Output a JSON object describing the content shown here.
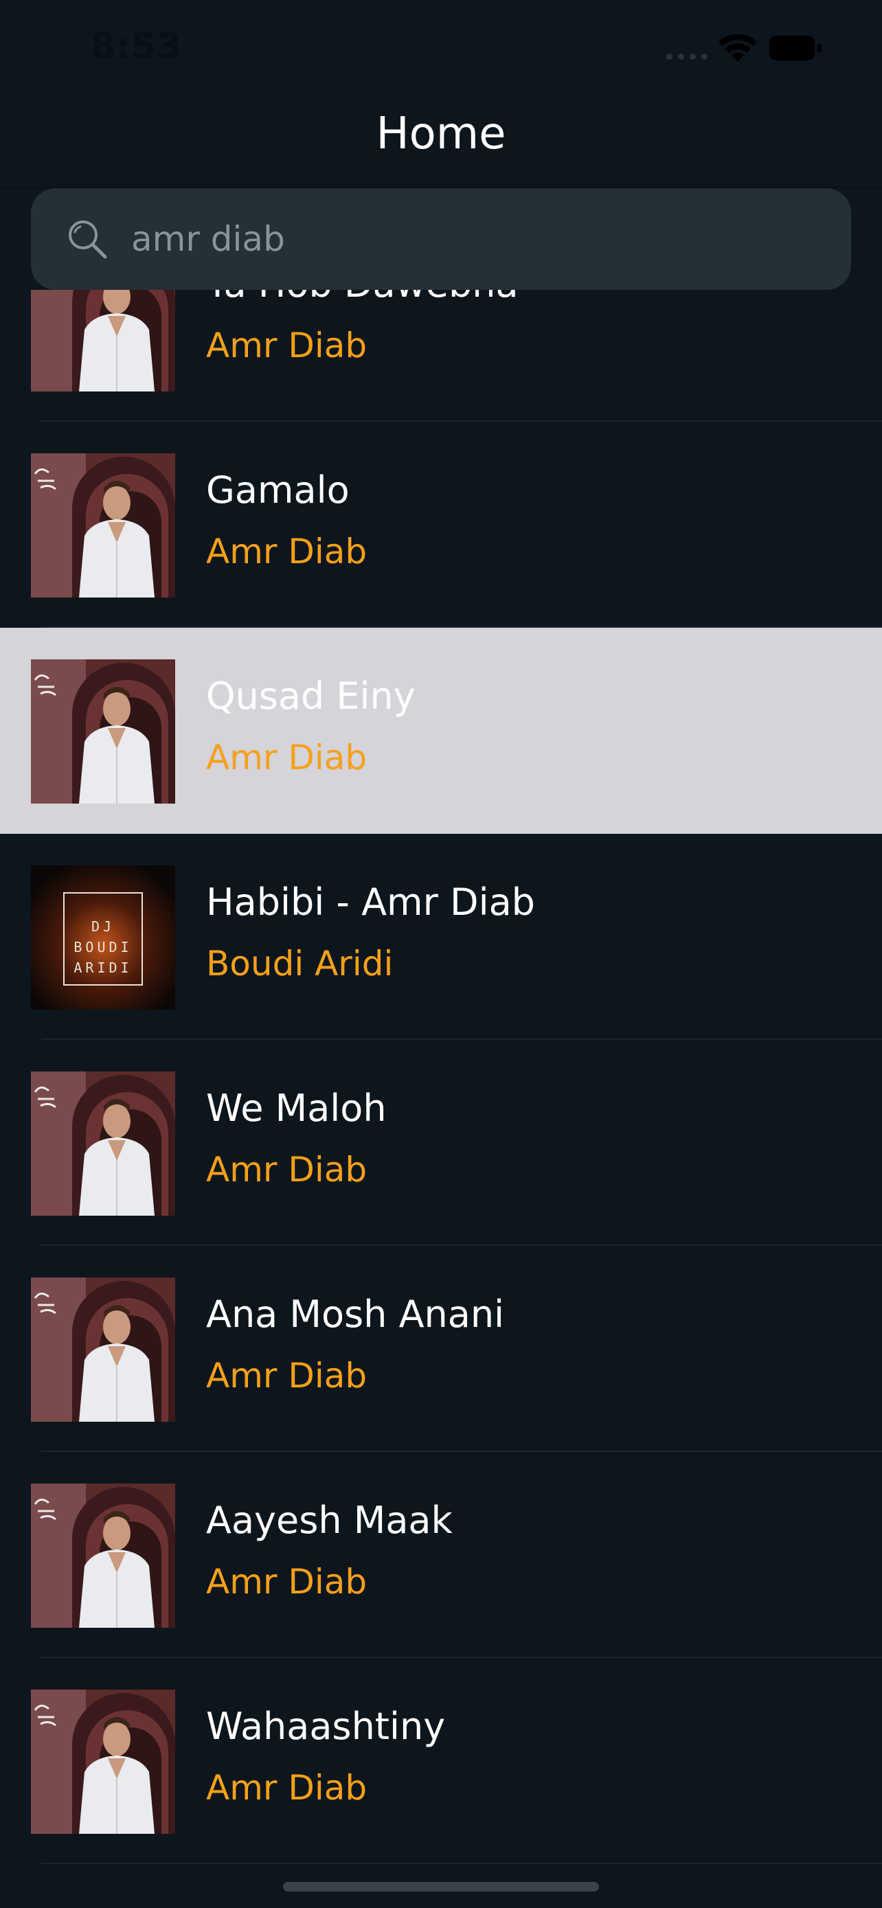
{
  "status_bar": {
    "time": "8:53"
  },
  "nav": {
    "title": "Home"
  },
  "search": {
    "value": "amr diab",
    "placeholder": ""
  },
  "colors": {
    "background": "#0d161c",
    "accent": "#f7a01b",
    "highlight": "#d4d4d9",
    "search_bg": "#252f36"
  },
  "songs": [
    {
      "title": "Ya Hob Dawebna",
      "artist": "Amr Diab",
      "cover": "amr-diab-album-cover"
    },
    {
      "title": "Gamalo",
      "artist": "Amr Diab",
      "cover": "amr-diab-album-cover"
    },
    {
      "title": "Qusad Einy",
      "artist": "Amr Diab",
      "cover": "amr-diab-album-cover",
      "selected": true
    },
    {
      "title": "Habibi - Amr Diab",
      "artist": "Boudi Aridi",
      "cover": "dj-boudi-aridi-cover",
      "cover_text": [
        "DJ",
        "BOUDI",
        "ARIDI"
      ]
    },
    {
      "title": "We Maloh",
      "artist": "Amr Diab",
      "cover": "amr-diab-album-cover"
    },
    {
      "title": "Ana Mosh Anani",
      "artist": "Amr Diab",
      "cover": "amr-diab-album-cover"
    },
    {
      "title": "Aayesh Maak",
      "artist": "Amr Diab",
      "cover": "amr-diab-album-cover"
    },
    {
      "title": "Wahaashtiny",
      "artist": "Amr Diab",
      "cover": "amr-diab-album-cover"
    }
  ]
}
